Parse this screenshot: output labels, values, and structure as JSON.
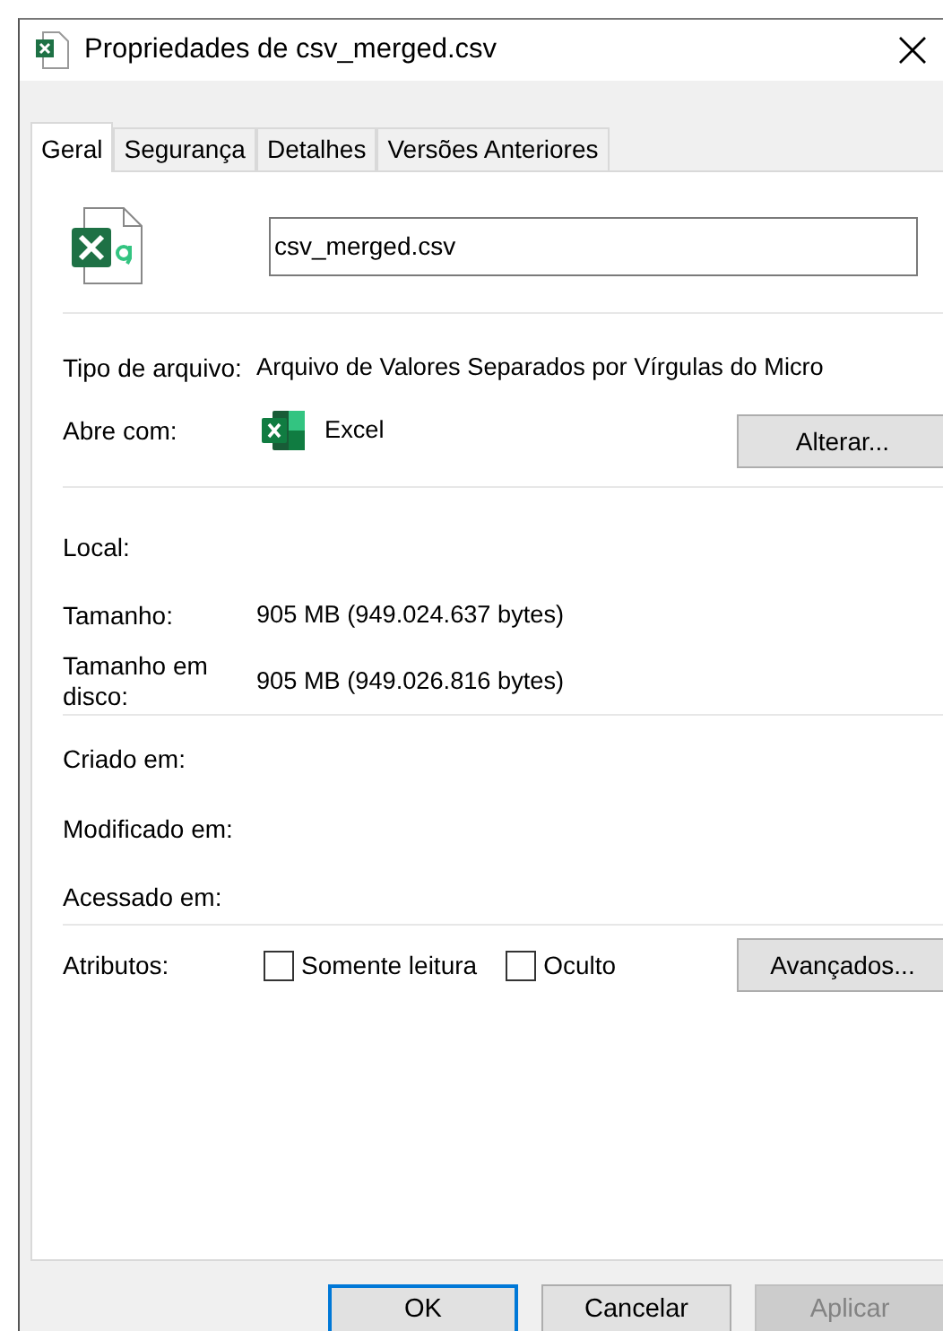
{
  "window": {
    "title": "Propriedades de csv_merged.csv"
  },
  "tabs": [
    {
      "label": "Geral",
      "selected": true
    },
    {
      "label": "Segurança",
      "selected": false
    },
    {
      "label": "Detalhes",
      "selected": false
    },
    {
      "label": "Versões Anteriores",
      "selected": false
    }
  ],
  "file_name": {
    "value": "csv_merged.csv"
  },
  "sections": [
    {
      "rows": [
        {
          "kind": "text",
          "label": "Tipo de arquivo:",
          "value": "Arquivo de Valores Separados por Vírgulas do Micro"
        },
        {
          "kind": "app",
          "label": "Abre com:",
          "value": "Excel",
          "button": "Alterar..."
        }
      ]
    },
    {
      "rows": [
        {
          "kind": "text",
          "label": "Local:"
        },
        {
          "kind": "text",
          "label": "Tamanho:",
          "value": "905 MB (949.024.637 bytes)"
        },
        {
          "kind": "text",
          "label": "Tamanho em disco:",
          "value": "905 MB (949.026.816 bytes)"
        }
      ]
    },
    {
      "rows": [
        {
          "kind": "text",
          "label": "Criado em:"
        },
        {
          "kind": "text",
          "label": "Modificado em:"
        },
        {
          "kind": "text",
          "label": "Acessado em:"
        }
      ]
    },
    {
      "rows": [
        {
          "kind": "attributes",
          "label": "Atributos:",
          "checkboxes": [
            {
              "label": "Somente leitura",
              "checked": false
            },
            {
              "label": "Oculto",
              "checked": false
            }
          ],
          "button": "Avançados..."
        }
      ]
    }
  ],
  "buttons": [
    {
      "label": "OK",
      "default": true,
      "disabled": false
    },
    {
      "label": "Cancelar",
      "default": false,
      "disabled": false
    },
    {
      "label": "Aplicar",
      "default": false,
      "disabled": true
    }
  ]
}
